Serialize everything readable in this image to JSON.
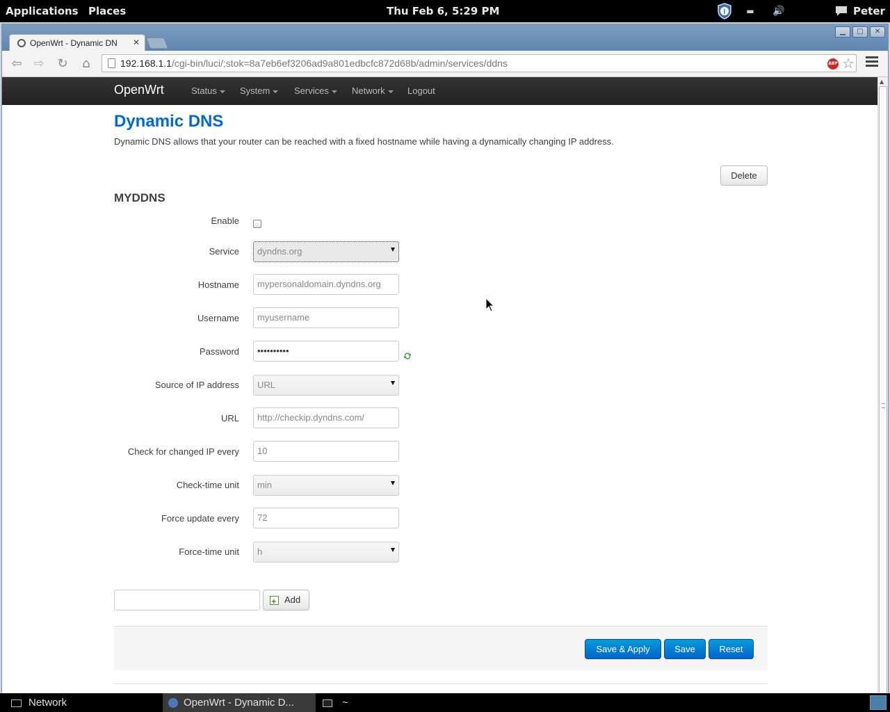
{
  "panel": {
    "applications": "Applications",
    "places": "Places",
    "clock": "Thu Feb  6,  5:29 PM",
    "user": "Peter"
  },
  "browser": {
    "tab_title": "OpenWrt - Dynamic DN",
    "url_host": "192.168.1.1",
    "url_path": "/cgi-bin/luci/;stok=8a7eb6ef3206ad9a801edbcfc872d68b/admin/services/ddns"
  },
  "nav": {
    "brand": "OpenWrt",
    "status": "Status",
    "system": "System",
    "services": "Services",
    "network": "Network",
    "logout": "Logout"
  },
  "page": {
    "title": "Dynamic DNS",
    "description": "Dynamic DNS allows that your router can be reached with a fixed hostname while having a dynamically changing IP address.",
    "delete_label": "Delete",
    "section_title": "MYDDNS"
  },
  "form": {
    "enable_label": "Enable",
    "enable_checked": false,
    "service_label": "Service",
    "service_value": "dyndns.org",
    "hostname_label": "Hostname",
    "hostname_value": "mypersonaldomain.dyndns.org",
    "username_label": "Username",
    "username_value": "myusername",
    "password_label": "Password",
    "password_value": "••••••••••",
    "ip_source_label": "Source of IP address",
    "ip_source_value": "URL",
    "url_label": "URL",
    "url_value": "http://checkip.dyndns.com/",
    "check_interval_label": "Check for changed IP every",
    "check_interval_value": "10",
    "check_unit_label": "Check-time unit",
    "check_unit_value": "min",
    "force_interval_label": "Force update every",
    "force_interval_value": "72",
    "force_unit_label": "Force-time unit",
    "force_unit_value": "h"
  },
  "actions": {
    "add_label": "Add",
    "save_apply_label": "Save & Apply",
    "save_label": "Save",
    "reset_label": "Reset"
  },
  "taskbar": {
    "network": "Network",
    "browser": "OpenWrt - Dynamic D...",
    "terminal": "~"
  },
  "colors": {
    "title_blue": "#0069d6",
    "primary_button": "#0064cd",
    "navbar": "#222222"
  }
}
